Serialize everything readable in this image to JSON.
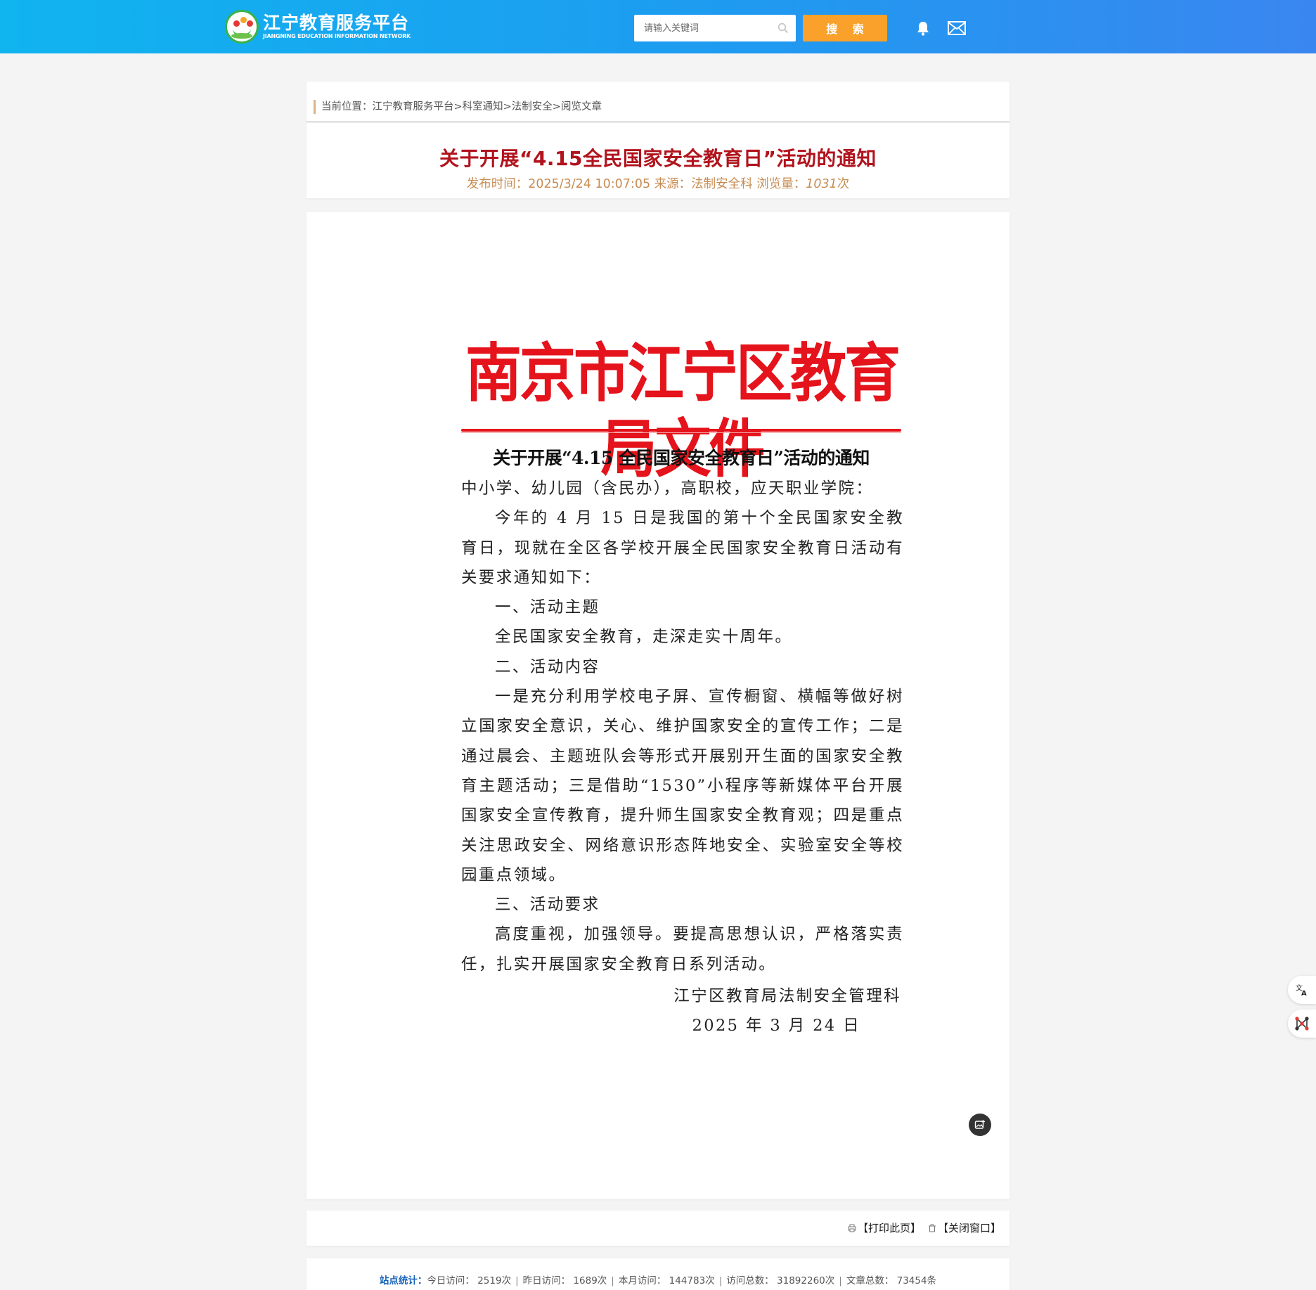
{
  "header": {
    "logo_cn": "江宁教育服务平台",
    "logo_en": "JIANGNING EDUCATION INFORMATION NETWORK",
    "search_placeholder": "请输入关键词",
    "search_button": "搜 索",
    "bg_color": "#1aa9f0",
    "button_color": "#f9a12a"
  },
  "breadcrumb": {
    "text": "当前位置：江宁教育服务平台>科室通知>法制安全>阅览文章"
  },
  "article": {
    "title": "关于开展“4.15全民国家安全教育日”活动的通知",
    "meta_prefix": "发布时间：2025/3/24 10:07:05 来源：法制安全科 浏览量：",
    "views": "1031",
    "views_suffix": "次",
    "title_color": "#b1131d"
  },
  "document": {
    "head": "南京市江宁区教育局文件",
    "title": "关于开展“4.15 全民国家安全教育日”活动的通知",
    "addressee": "中小学、幼儿园（含民办），高职校，应天职业学院：",
    "intro": "今年的 4 月 15 日是我国的第十个全民国家安全教育日，现就在全区各学校开展全民国家安全教育日活动有关要求通知如下：",
    "section1_title": "一、活动主题",
    "section1_body": "全民国家安全教育，走深走实十周年。",
    "section2_title": "二、活动内容",
    "section2_body": "一是充分利用学校电子屏、宣传橱窗、横幅等做好树立国家安全意识，关心、维护国家安全的宣传工作；二是通过晨会、主题班队会等形式开展别开生面的国家安全教育主题活动；三是借助“1530”小程序等新媒体平台开展国家安全宣传教育，提升师生国家安全教育观；四是重点关注思政安全、网络意识形态阵地安全、实验室安全等校园重点领域。",
    "section3_title": "三、活动要求",
    "section3_body": "高度重视，加强领导。要提高思想认识，严格落实责任，扎实开展国家安全教育日系列活动。",
    "signer": "江宁区教育局法制安全管理科",
    "date": "2025 年 3 月 24 日",
    "head_color": "#e5131b"
  },
  "actions": {
    "print": "【打印此页】",
    "close": "【关闭窗口】"
  },
  "stats": {
    "label": "站点统计：",
    "today": "今日访问：  2519次",
    "yesterday": "昨日访问：  1689次",
    "month": "本月访问：  144783次",
    "total": "访问总数：  31892260次",
    "articles": "文章总数：  73454条"
  }
}
